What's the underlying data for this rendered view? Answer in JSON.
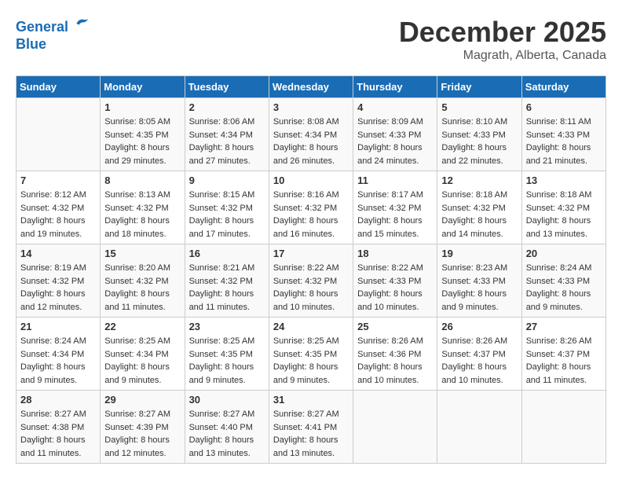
{
  "header": {
    "logo_line1": "General",
    "logo_line2": "Blue",
    "month_year": "December 2025",
    "location": "Magrath, Alberta, Canada"
  },
  "days_of_week": [
    "Sunday",
    "Monday",
    "Tuesday",
    "Wednesday",
    "Thursday",
    "Friday",
    "Saturday"
  ],
  "weeks": [
    [
      {
        "day": "",
        "info": ""
      },
      {
        "day": "1",
        "info": "Sunrise: 8:05 AM\nSunset: 4:35 PM\nDaylight: 8 hours\nand 29 minutes."
      },
      {
        "day": "2",
        "info": "Sunrise: 8:06 AM\nSunset: 4:34 PM\nDaylight: 8 hours\nand 27 minutes."
      },
      {
        "day": "3",
        "info": "Sunrise: 8:08 AM\nSunset: 4:34 PM\nDaylight: 8 hours\nand 26 minutes."
      },
      {
        "day": "4",
        "info": "Sunrise: 8:09 AM\nSunset: 4:33 PM\nDaylight: 8 hours\nand 24 minutes."
      },
      {
        "day": "5",
        "info": "Sunrise: 8:10 AM\nSunset: 4:33 PM\nDaylight: 8 hours\nand 22 minutes."
      },
      {
        "day": "6",
        "info": "Sunrise: 8:11 AM\nSunset: 4:33 PM\nDaylight: 8 hours\nand 21 minutes."
      }
    ],
    [
      {
        "day": "7",
        "info": "Sunrise: 8:12 AM\nSunset: 4:32 PM\nDaylight: 8 hours\nand 19 minutes."
      },
      {
        "day": "8",
        "info": "Sunrise: 8:13 AM\nSunset: 4:32 PM\nDaylight: 8 hours\nand 18 minutes."
      },
      {
        "day": "9",
        "info": "Sunrise: 8:15 AM\nSunset: 4:32 PM\nDaylight: 8 hours\nand 17 minutes."
      },
      {
        "day": "10",
        "info": "Sunrise: 8:16 AM\nSunset: 4:32 PM\nDaylight: 8 hours\nand 16 minutes."
      },
      {
        "day": "11",
        "info": "Sunrise: 8:17 AM\nSunset: 4:32 PM\nDaylight: 8 hours\nand 15 minutes."
      },
      {
        "day": "12",
        "info": "Sunrise: 8:18 AM\nSunset: 4:32 PM\nDaylight: 8 hours\nand 14 minutes."
      },
      {
        "day": "13",
        "info": "Sunrise: 8:18 AM\nSunset: 4:32 PM\nDaylight: 8 hours\nand 13 minutes."
      }
    ],
    [
      {
        "day": "14",
        "info": "Sunrise: 8:19 AM\nSunset: 4:32 PM\nDaylight: 8 hours\nand 12 minutes."
      },
      {
        "day": "15",
        "info": "Sunrise: 8:20 AM\nSunset: 4:32 PM\nDaylight: 8 hours\nand 11 minutes."
      },
      {
        "day": "16",
        "info": "Sunrise: 8:21 AM\nSunset: 4:32 PM\nDaylight: 8 hours\nand 11 minutes."
      },
      {
        "day": "17",
        "info": "Sunrise: 8:22 AM\nSunset: 4:32 PM\nDaylight: 8 hours\nand 10 minutes."
      },
      {
        "day": "18",
        "info": "Sunrise: 8:22 AM\nSunset: 4:33 PM\nDaylight: 8 hours\nand 10 minutes."
      },
      {
        "day": "19",
        "info": "Sunrise: 8:23 AM\nSunset: 4:33 PM\nDaylight: 8 hours\nand 9 minutes."
      },
      {
        "day": "20",
        "info": "Sunrise: 8:24 AM\nSunset: 4:33 PM\nDaylight: 8 hours\nand 9 minutes."
      }
    ],
    [
      {
        "day": "21",
        "info": "Sunrise: 8:24 AM\nSunset: 4:34 PM\nDaylight: 8 hours\nand 9 minutes."
      },
      {
        "day": "22",
        "info": "Sunrise: 8:25 AM\nSunset: 4:34 PM\nDaylight: 8 hours\nand 9 minutes."
      },
      {
        "day": "23",
        "info": "Sunrise: 8:25 AM\nSunset: 4:35 PM\nDaylight: 8 hours\nand 9 minutes."
      },
      {
        "day": "24",
        "info": "Sunrise: 8:25 AM\nSunset: 4:35 PM\nDaylight: 8 hours\nand 9 minutes."
      },
      {
        "day": "25",
        "info": "Sunrise: 8:26 AM\nSunset: 4:36 PM\nDaylight: 8 hours\nand 10 minutes."
      },
      {
        "day": "26",
        "info": "Sunrise: 8:26 AM\nSunset: 4:37 PM\nDaylight: 8 hours\nand 10 minutes."
      },
      {
        "day": "27",
        "info": "Sunrise: 8:26 AM\nSunset: 4:37 PM\nDaylight: 8 hours\nand 11 minutes."
      }
    ],
    [
      {
        "day": "28",
        "info": "Sunrise: 8:27 AM\nSunset: 4:38 PM\nDaylight: 8 hours\nand 11 minutes."
      },
      {
        "day": "29",
        "info": "Sunrise: 8:27 AM\nSunset: 4:39 PM\nDaylight: 8 hours\nand 12 minutes."
      },
      {
        "day": "30",
        "info": "Sunrise: 8:27 AM\nSunset: 4:40 PM\nDaylight: 8 hours\nand 13 minutes."
      },
      {
        "day": "31",
        "info": "Sunrise: 8:27 AM\nSunset: 4:41 PM\nDaylight: 8 hours\nand 13 minutes."
      },
      {
        "day": "",
        "info": ""
      },
      {
        "day": "",
        "info": ""
      },
      {
        "day": "",
        "info": ""
      }
    ]
  ]
}
